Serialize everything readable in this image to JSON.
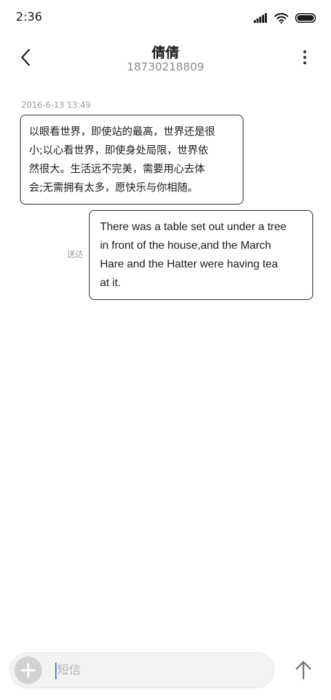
{
  "status_bar": {
    "time": "2:36",
    "icons": [
      "signal-icon",
      "wifi-icon",
      "battery-icon"
    ]
  },
  "header": {
    "contact_name": "倩倩",
    "contact_number": "18730218809",
    "back_icon": "chevron-left-icon",
    "menu_icon": "more-vertical-icon"
  },
  "conversation": {
    "timestamp": "2016-6-13 13:49",
    "incoming": {
      "lines": [
        "以眼看世界，即使站的最高，世界还是很",
        "小;以心看世界，即使身处局限，世界依",
        "然很大。生活远不完美，需要用心去体",
        "会;无需拥有太多，愿快乐与你相随。"
      ]
    },
    "outgoing": {
      "status": "送达",
      "lines": [
        "There was a table set out under a tree",
        "in front of the house,and the March",
        "Hare and the Hatter were having tea",
        "at it."
      ]
    }
  },
  "composer": {
    "placeholder": "短信",
    "value": "",
    "add_icon": "plus-icon",
    "send_icon": "arrow-up-icon"
  },
  "colors": {
    "bubble_border": "#222222",
    "muted_text": "#9a9a9a",
    "composer_bg": "#f3f3f3",
    "caret": "#3b82f6"
  }
}
